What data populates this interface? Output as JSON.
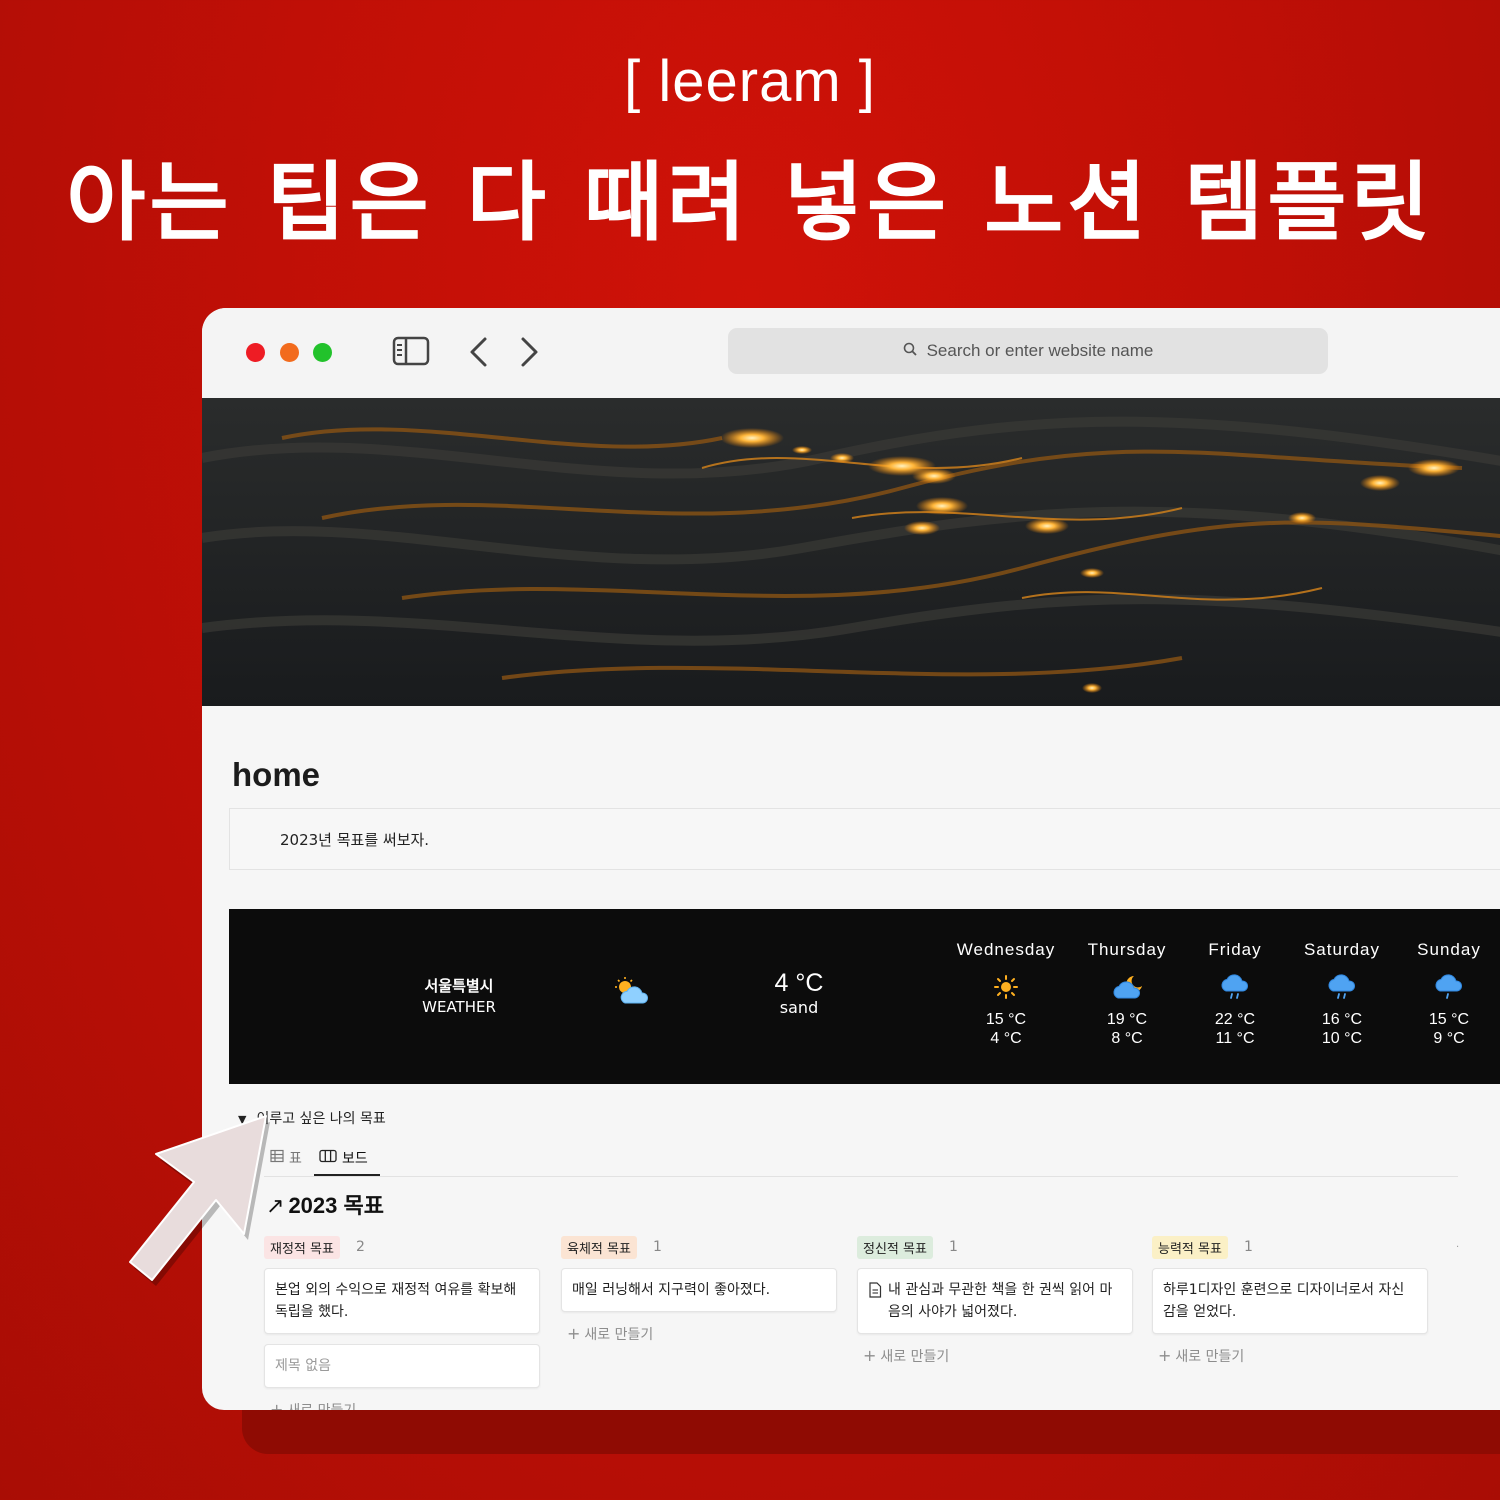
{
  "poster": {
    "brand": "[ leeram ]",
    "headline": "아는 팁은 다 때려 넣은 노션 템플릿"
  },
  "browser": {
    "search_placeholder": "Search or enter website name",
    "traffic_lights": {
      "close": "#ee1c24",
      "minimize": "#f26b1d",
      "zoom": "#22c22b"
    },
    "icons": [
      "sidebar-icon",
      "back-arrow-icon",
      "forward-arrow-icon",
      "search-icon"
    ]
  },
  "page": {
    "title": "home",
    "callout_text": "2023년 목표를 써보자."
  },
  "weather": {
    "city": "서울특별시",
    "label": "WEATHER",
    "current": {
      "temp": "4 °C",
      "desc": "sand",
      "icon": "sun-cloud-icon"
    },
    "forecast": [
      {
        "day": "Wednesday",
        "high": "15 °C",
        "low": "4 °C",
        "icon": "sun-icon"
      },
      {
        "day": "Thursday",
        "high": "19 °C",
        "low": "8 °C",
        "icon": "moon-cloud-icon"
      },
      {
        "day": "Friday",
        "high": "22 °C",
        "low": "11 °C",
        "icon": "rain-cloud-icon"
      },
      {
        "day": "Saturday",
        "high": "16 °C",
        "low": "10 °C",
        "icon": "rain-cloud-icon"
      },
      {
        "day": "Sunday",
        "high": "15 °C",
        "low": "9 °C",
        "icon": "rain-cloud-icon"
      }
    ]
  },
  "goals": {
    "toggle_label": "이루고 싶은 나의 목표",
    "tabs": [
      {
        "label": "표",
        "icon": "table-icon"
      },
      {
        "label": "보드",
        "icon": "board-icon"
      }
    ],
    "db_title": "2023 목표",
    "new_label": "새로 만들기",
    "columns": [
      {
        "tag": "재정적 목표",
        "tag_color": "#fbe4e4",
        "count": "2",
        "cards": [
          "본업 외의 수익으로 재정적 여유를 확보해 독립을 했다.",
          "제목 없음"
        ]
      },
      {
        "tag": "육체적 목표",
        "tag_color": "#fbe4d3",
        "count": "1",
        "cards": [
          "매일 러닝해서 지구력이 좋아졌다."
        ]
      },
      {
        "tag": "정신적 목표",
        "tag_color": "#dcecdd",
        "count": "1",
        "cards": [
          "내 관심과 무관한 책을 한 권씩 읽어 마음의 사야가 넓어졌다."
        ]
      },
      {
        "tag": "능력적 목표",
        "tag_color": "#fbf0c6",
        "count": "1",
        "cards": [
          "하루1디자인 훈련으로 디자이너로서 자신감을 얻었다."
        ]
      }
    ]
  }
}
